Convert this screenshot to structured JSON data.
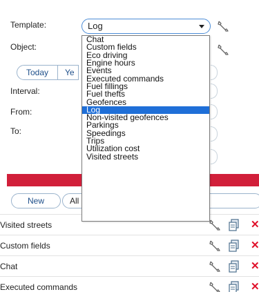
{
  "form": {
    "template_label": "Template:",
    "object_label": "Object:",
    "interval_label": "Interval:",
    "from_label": "From:",
    "to_label": "To:",
    "template_value": "Log",
    "period_buttons": [
      "Today",
      "Ye"
    ]
  },
  "dropdown": {
    "options": [
      "Chat",
      "Custom fields",
      "Eco driving",
      "Engine hours",
      "Events",
      "Executed commands",
      "Fuel fillings",
      "Fuel thefts",
      "Geofences",
      "Log",
      "Non-visited geofences",
      "Parkings",
      "Speedings",
      "Trips",
      "Utilization cost",
      "Visited streets"
    ],
    "selected": "Log"
  },
  "toolbar": {
    "new_label": "New",
    "filter_value": "All"
  },
  "templates_list": [
    {
      "name": "Visited streets"
    },
    {
      "name": "Custom fields"
    },
    {
      "name": "Chat"
    },
    {
      "name": "Executed commands"
    }
  ],
  "colors": {
    "accent_bar": "#d11f3a",
    "selected_option": "#1f6fd8",
    "delete_icon": "#e0102a",
    "button_text": "#1e4f8a"
  }
}
